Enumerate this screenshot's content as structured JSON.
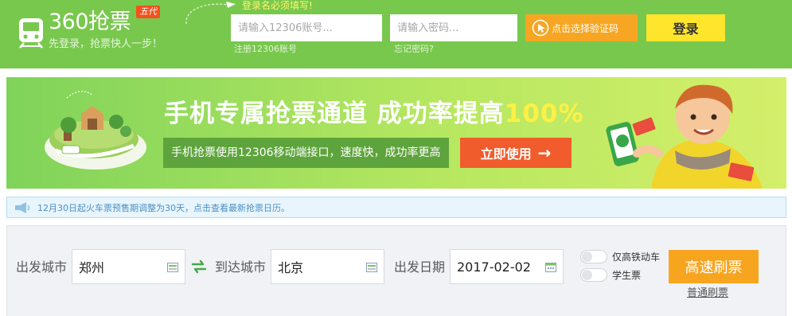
{
  "header": {
    "logo_text": "360抢票",
    "logo_badge": "五代",
    "slogan": "先登录，抢票快人一步！",
    "login_hint": "登录名必须填写!",
    "username_placeholder": "请输入12306账号...",
    "password_placeholder": "请输入密码...",
    "register_link": "注册12306账号",
    "forgot_link": "忘记密码?",
    "captcha_button": "点击选择验证码",
    "login_button": "登录"
  },
  "banner": {
    "title_main": "手机专属抢票通道 成功率提高",
    "title_highlight": "100%",
    "subtitle": "手机抢票使用12306移动端接口，速度快，成功率更高",
    "cta_label": "立即使用",
    "cta_arrow": "→"
  },
  "notice": {
    "icon": "megaphone-icon",
    "text": "12月30日起火车票预售期调整为30天，点击查看最新抢票日历。"
  },
  "search": {
    "from_label": "出发城市",
    "from_value": "郑州",
    "to_label": "到达城市",
    "to_value": "北京",
    "date_label": "出发日期",
    "date_value": "2017-02-02",
    "high_speed_label": "仅高铁动车",
    "student_label": "学生票",
    "fast_button": "高速刷票",
    "normal_link": "普通刷票"
  },
  "colors": {
    "header_green": "#78c84e",
    "captcha_orange": "#f6a623",
    "login_yellow": "#ffe52b",
    "cta_red": "#f15c2c",
    "search_orange": "#f7a51f",
    "notice_blue": "#4a8fc5"
  }
}
